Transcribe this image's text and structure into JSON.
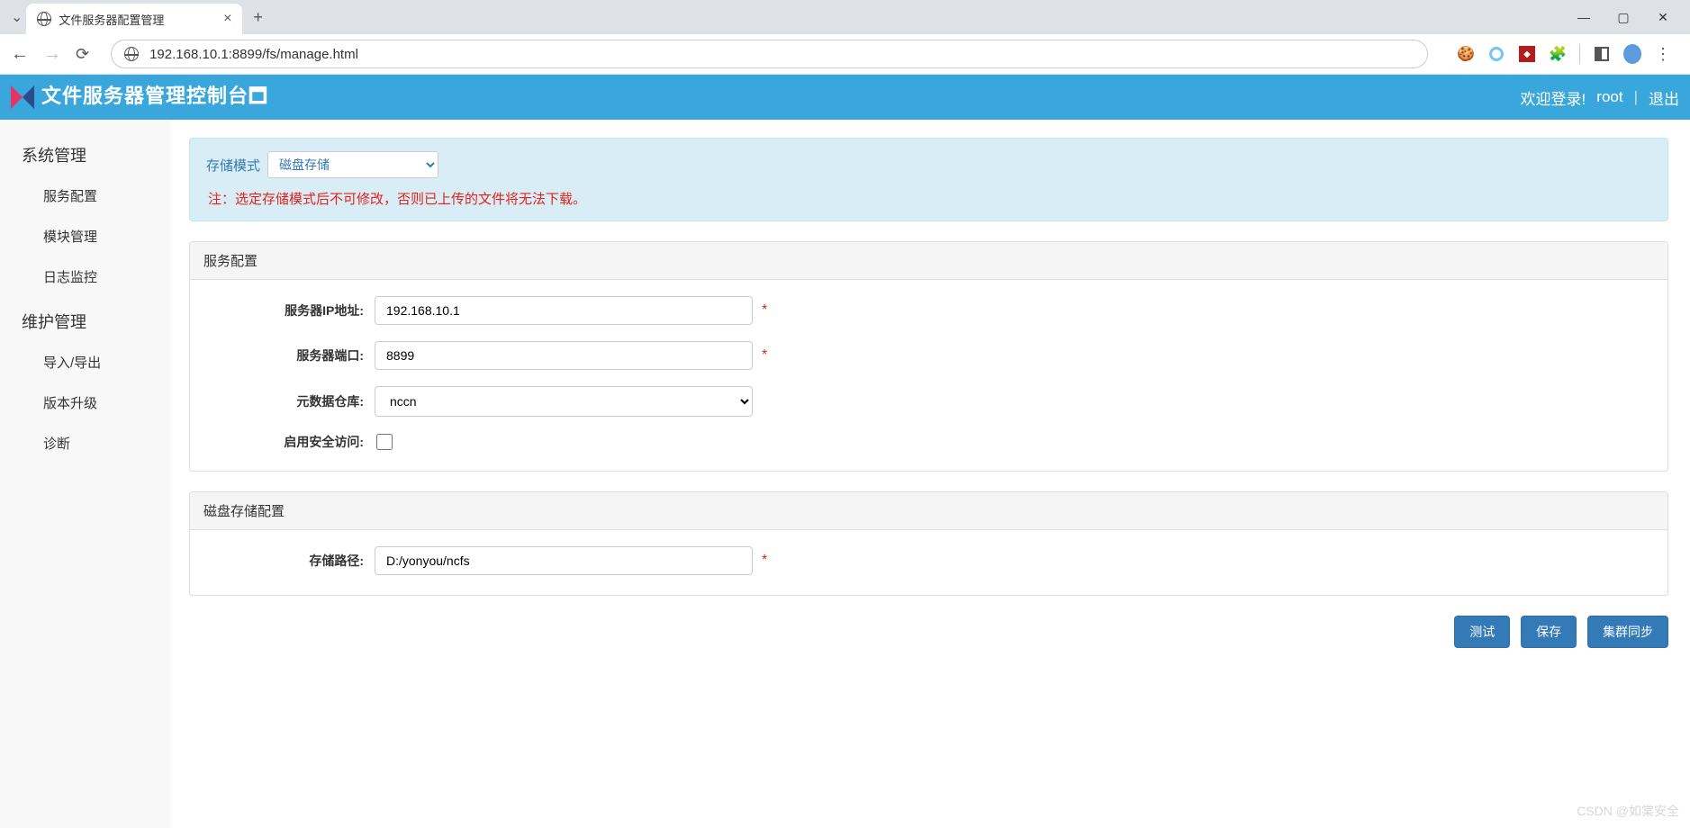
{
  "browser": {
    "tab_title": "文件服务器配置管理",
    "url": "192.168.10.1:8899/fs/manage.html",
    "close_glyph": "×",
    "new_tab_glyph": "+",
    "min_glyph": "—",
    "max_glyph": "▢",
    "close_win_glyph": "✕",
    "back_glyph": "←",
    "forward_glyph": "→",
    "reload_glyph": "⟳",
    "menu_glyph": "⋮"
  },
  "header": {
    "title": "文件服务器管理控制台🗖",
    "welcome": "欢迎登录!",
    "user": "root",
    "sep": "|",
    "logout": "退出"
  },
  "sidebar": {
    "group1": "系统管理",
    "items1": {
      "a": "服务配置",
      "b": "模块管理",
      "c": "日志监控"
    },
    "group2": "维护管理",
    "items2": {
      "a": "导入/导出",
      "b": "版本升级",
      "c": "诊断"
    }
  },
  "alert": {
    "storage_label": "存储模式",
    "storage_value": "磁盘存储",
    "note": "注：选定存储模式后不可修改，否则已上传的文件将无法下载。"
  },
  "panel_service": {
    "title": "服务配置",
    "ip_label": "服务器IP地址:",
    "ip_value": "192.168.10.1",
    "port_label": "服务器端口:",
    "port_value": "8899",
    "repo_label": "元数据仓库:",
    "repo_value": "nccn",
    "secure_label": "启用安全访问:",
    "required": "*"
  },
  "panel_disk": {
    "title": "磁盘存储配置",
    "path_label": "存储路径:",
    "path_value": "D:/yonyou/ncfs",
    "required": "*"
  },
  "buttons": {
    "test": "测试",
    "save": "保存",
    "sync": "集群同步"
  },
  "watermark": "CSDN @如棠安全"
}
